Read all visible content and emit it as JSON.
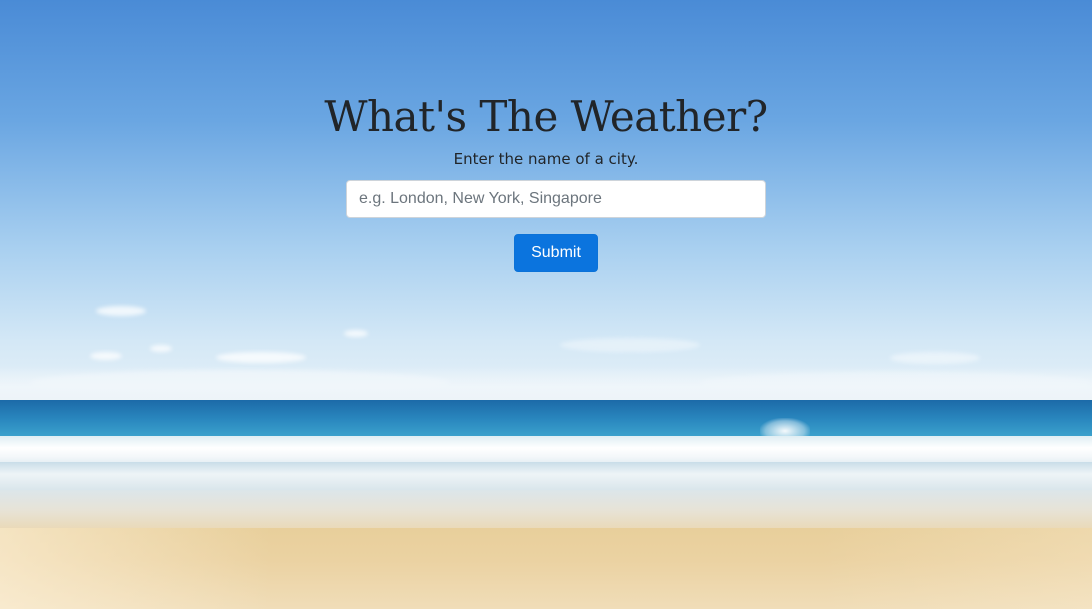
{
  "header": {
    "title": "What's The Weather?",
    "subtitle": "Enter the name of a city."
  },
  "search": {
    "value": "",
    "placeholder": "e.g. London, New York, Singapore"
  },
  "form": {
    "submit_label": "Submit"
  },
  "colors": {
    "button_background": "#0b74de",
    "button_text": "#ffffff",
    "heading_text": "#212529"
  }
}
